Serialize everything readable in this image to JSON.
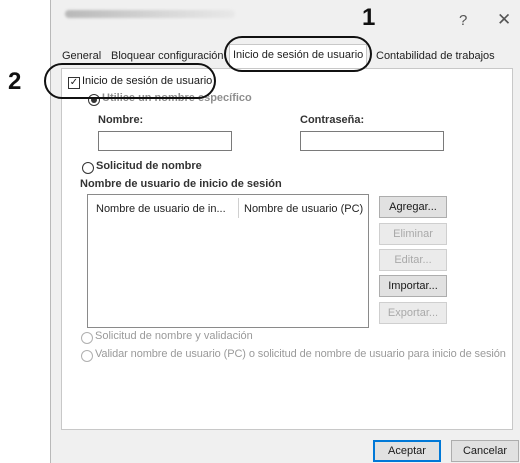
{
  "window": {
    "help_label": "?",
    "close_label": "✕"
  },
  "tabs": [
    {
      "label": "General"
    },
    {
      "label": "Bloquear configuración"
    },
    {
      "label": "Inicio de sesión de usuario"
    },
    {
      "label": "Contabilidad de trabajos"
    }
  ],
  "callouts": [
    "1",
    "2"
  ],
  "login": {
    "enable_label": "Inicio de sesión de usuario",
    "enable_checked": true,
    "specific_name_label": "Utilice un nombre específico",
    "name_label": "Nombre:",
    "password_label": "Contraseña:",
    "name_value": "",
    "password_value": "",
    "prompt_name_label": "Solicitud de nombre",
    "list_title": "Nombre de usuario de inicio de sesión",
    "columns": [
      "Nombre de usuario de in...",
      "Nombre de usuario (PC)"
    ],
    "rows": [],
    "buttons": {
      "add": "Agregar...",
      "delete": "Eliminar",
      "edit": "Editar...",
      "import": "Importar...",
      "export": "Exportar..."
    },
    "prompt_validate_label": "Solicitud de nombre y validación",
    "validate_pc_label": "Validar nombre de usuario (PC) o solicitud de nombre de usuario para inicio de sesión"
  },
  "footer": {
    "ok_label": "Aceptar",
    "cancel_label": "Cancelar"
  }
}
